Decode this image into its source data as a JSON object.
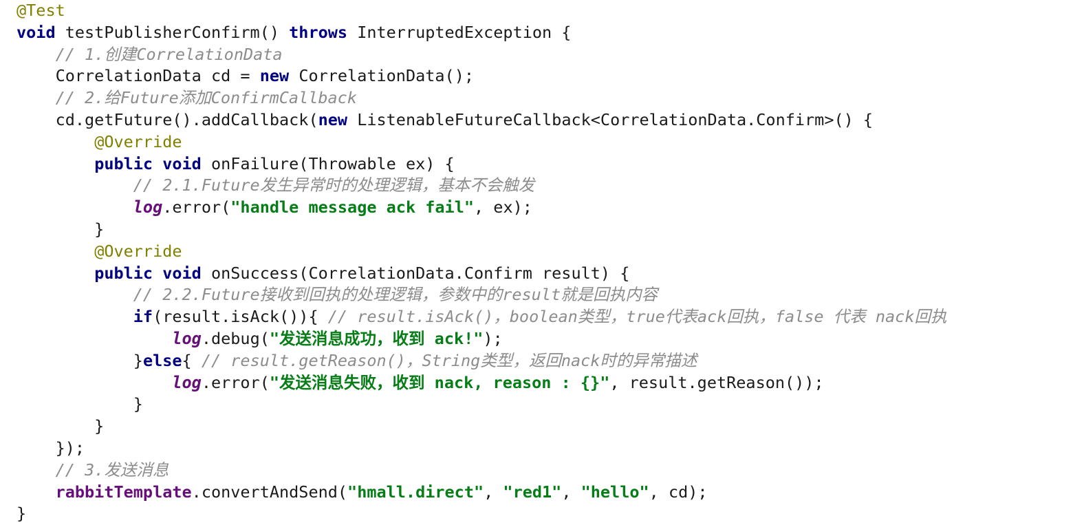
{
  "code": {
    "lines": [
      [
        {
          "t": "ann",
          "v": "@Test"
        }
      ],
      [
        {
          "t": "kw",
          "v": "void"
        },
        {
          "t": "pl",
          "v": " testPublisherConfirm() "
        },
        {
          "t": "kw",
          "v": "throws"
        },
        {
          "t": "pl",
          "v": " InterruptedException {"
        }
      ],
      [
        {
          "t": "pl",
          "v": "    "
        },
        {
          "t": "cm",
          "v": "// 1.创建CorrelationData"
        }
      ],
      [
        {
          "t": "pl",
          "v": "    CorrelationData cd = "
        },
        {
          "t": "kw",
          "v": "new"
        },
        {
          "t": "pl",
          "v": " CorrelationData();"
        }
      ],
      [
        {
          "t": "pl",
          "v": "    "
        },
        {
          "t": "cm",
          "v": "// 2.给Future添加ConfirmCallback"
        }
      ],
      [
        {
          "t": "pl",
          "v": "    cd.getFuture().addCallback("
        },
        {
          "t": "kw",
          "v": "new"
        },
        {
          "t": "pl",
          "v": " ListenableFutureCallback<CorrelationData.Confirm>() {"
        }
      ],
      [
        {
          "t": "pl",
          "v": "        "
        },
        {
          "t": "ann",
          "v": "@Override"
        }
      ],
      [
        {
          "t": "pl",
          "v": "        "
        },
        {
          "t": "kw",
          "v": "public"
        },
        {
          "t": "pl",
          "v": " "
        },
        {
          "t": "kw",
          "v": "void"
        },
        {
          "t": "pl",
          "v": " onFailure(Throwable ex) {"
        }
      ],
      [
        {
          "t": "pl",
          "v": "            "
        },
        {
          "t": "cm",
          "v": "// 2.1.Future发生异常时的处理逻辑，基本不会触发"
        }
      ],
      [
        {
          "t": "pl",
          "v": "            "
        },
        {
          "t": "fld",
          "v": "log"
        },
        {
          "t": "pl",
          "v": ".error("
        },
        {
          "t": "str",
          "v": "\"handle message ack fail\""
        },
        {
          "t": "pl",
          "v": ", ex);"
        }
      ],
      [
        {
          "t": "pl",
          "v": "        }"
        }
      ],
      [
        {
          "t": "pl",
          "v": "        "
        },
        {
          "t": "ann",
          "v": "@Override"
        }
      ],
      [
        {
          "t": "pl",
          "v": "        "
        },
        {
          "t": "kw",
          "v": "public"
        },
        {
          "t": "pl",
          "v": " "
        },
        {
          "t": "kw",
          "v": "void"
        },
        {
          "t": "pl",
          "v": " onSuccess(CorrelationData.Confirm result) {"
        }
      ],
      [
        {
          "t": "pl",
          "v": "            "
        },
        {
          "t": "cm",
          "v": "// 2.2.Future接收到回执的处理逻辑，参数中的result就是回执内容"
        }
      ],
      [
        {
          "t": "pl",
          "v": "            "
        },
        {
          "t": "kw",
          "v": "if"
        },
        {
          "t": "pl",
          "v": "(result.isAck()){ "
        },
        {
          "t": "cm",
          "v": "// result.isAck()，boolean类型，true代表ack回执，false 代表 nack回执"
        }
      ],
      [
        {
          "t": "pl",
          "v": "                "
        },
        {
          "t": "fld",
          "v": "log"
        },
        {
          "t": "pl",
          "v": ".debug("
        },
        {
          "t": "str",
          "v": "\"发送消息成功，收到 ack!\""
        },
        {
          "t": "pl",
          "v": ");"
        }
      ],
      [
        {
          "t": "pl",
          "v": "            }"
        },
        {
          "t": "kw",
          "v": "else"
        },
        {
          "t": "pl",
          "v": "{ "
        },
        {
          "t": "cm",
          "v": "// result.getReason()，String类型，返回nack时的异常描述"
        }
      ],
      [
        {
          "t": "pl",
          "v": "                "
        },
        {
          "t": "fld",
          "v": "log"
        },
        {
          "t": "pl",
          "v": ".error("
        },
        {
          "t": "str",
          "v": "\"发送消息失败，收到 nack, reason : {}\""
        },
        {
          "t": "pl",
          "v": ", result.getReason());"
        }
      ],
      [
        {
          "t": "pl",
          "v": "            }"
        }
      ],
      [
        {
          "t": "pl",
          "v": "        }"
        }
      ],
      [
        {
          "t": "pl",
          "v": "    });"
        }
      ],
      [
        {
          "t": "pl",
          "v": "    "
        },
        {
          "t": "cm",
          "v": "// 3.发送消息"
        }
      ],
      [
        {
          "t": "pl",
          "v": "    "
        },
        {
          "t": "fld2",
          "v": "rabbitTemplate"
        },
        {
          "t": "pl",
          "v": ".convertAndSend("
        },
        {
          "t": "str",
          "v": "\"hmall.direct\""
        },
        {
          "t": "pl",
          "v": ", "
        },
        {
          "t": "str",
          "v": "\"red1\""
        },
        {
          "t": "pl",
          "v": ", "
        },
        {
          "t": "str",
          "v": "\"hello\""
        },
        {
          "t": "pl",
          "v": ", cd);"
        }
      ],
      [
        {
          "t": "pl",
          "v": "}"
        }
      ]
    ]
  }
}
